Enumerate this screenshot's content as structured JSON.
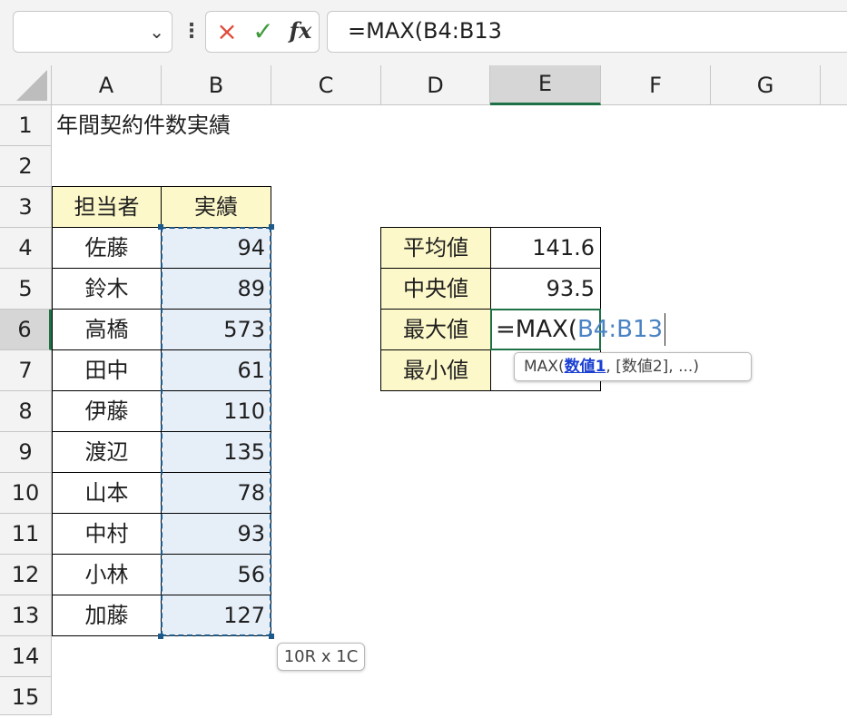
{
  "formula_bar": {
    "name_box_value": "",
    "cancel_icon": "×",
    "enter_icon": "✓",
    "fx_label": "fx",
    "formula": "=MAX(B4:B13"
  },
  "columns": [
    "A",
    "B",
    "C",
    "D",
    "E",
    "F",
    "G"
  ],
  "rows": [
    "1",
    "2",
    "3",
    "4",
    "5",
    "6",
    "7",
    "8",
    "9",
    "10",
    "11",
    "12",
    "13",
    "14",
    "15"
  ],
  "title": "年間契約件数実績",
  "table": {
    "headers": [
      "担当者",
      "実績"
    ],
    "records": [
      {
        "name": "佐藤",
        "value": "94"
      },
      {
        "name": "鈴木",
        "value": "89"
      },
      {
        "name": "高橋",
        "value": "573"
      },
      {
        "name": "田中",
        "value": "61"
      },
      {
        "name": "伊藤",
        "value": "110"
      },
      {
        "name": "渡辺",
        "value": "135"
      },
      {
        "name": "山本",
        "value": "78"
      },
      {
        "name": "中村",
        "value": "93"
      },
      {
        "name": "小林",
        "value": "56"
      },
      {
        "name": "加藤",
        "value": "127"
      }
    ]
  },
  "stats": {
    "rows": [
      {
        "label": "平均値",
        "value": "141.6"
      },
      {
        "label": "中央値",
        "value": "93.5"
      },
      {
        "label": "最大値",
        "value": ""
      },
      {
        "label": "最小値",
        "value": ""
      }
    ]
  },
  "editing": {
    "prefix": "=MAX(",
    "reference": "B4:B13"
  },
  "tooltip": {
    "func": "MAX(",
    "arg1": "数値1",
    "rest": ", [数値2], ...)"
  },
  "selection_size": "10R x 1C",
  "colors": {
    "header_fill": "#fdf8c9",
    "selection_fill": "#e6eef8",
    "active_border": "#1e7145",
    "reference_text": "#4a83c4"
  }
}
